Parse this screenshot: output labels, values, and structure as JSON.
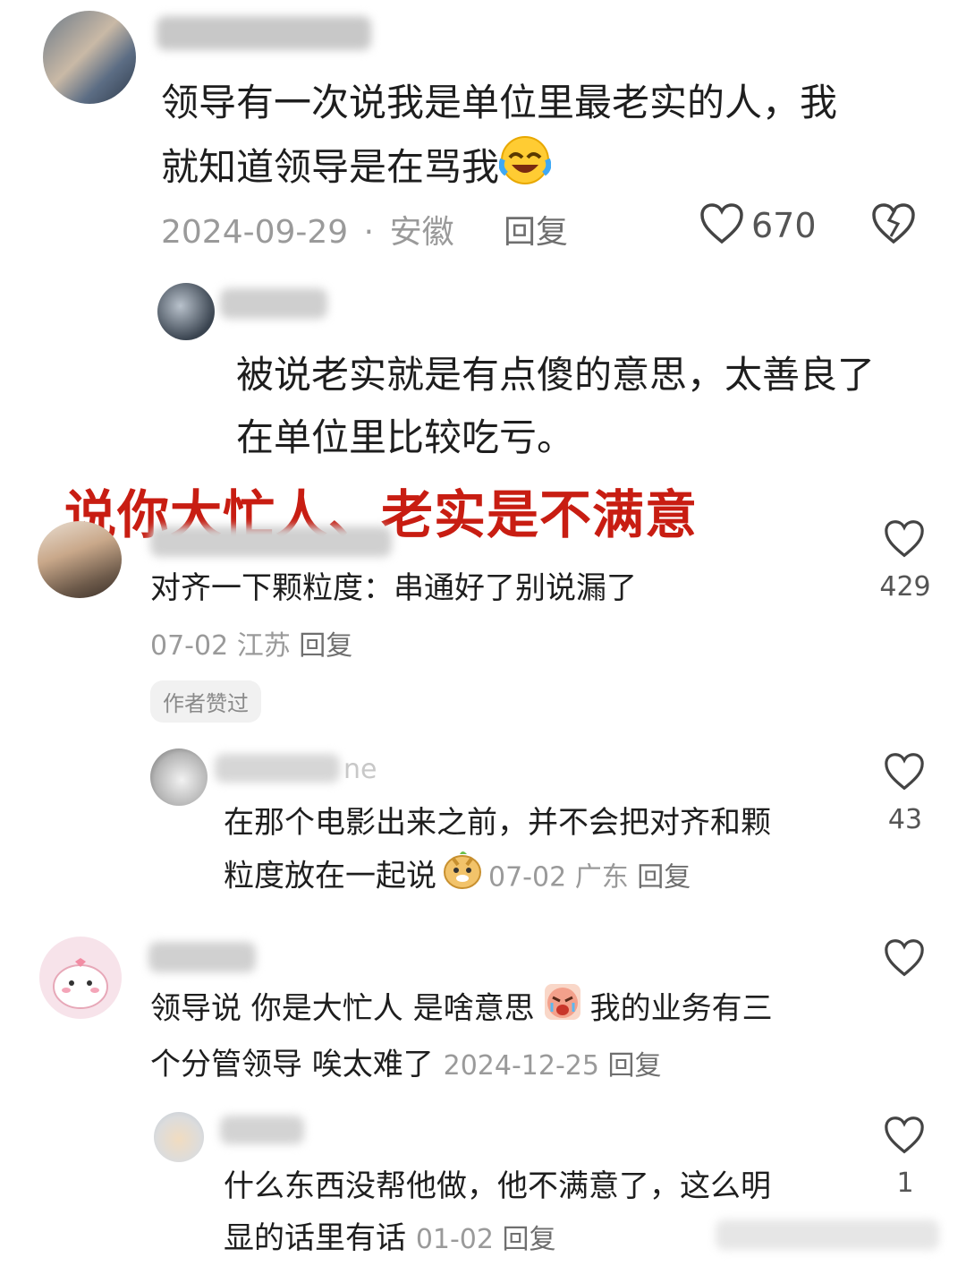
{
  "comment1": {
    "text_line1": "领导有一次说我是单位里最老实的人，我",
    "text_line2": "就知道领导是在骂我",
    "date": "2024-09-29",
    "sep": "·",
    "location": "安徽",
    "reply": "回复",
    "likes": "670"
  },
  "reply1": {
    "text_line1": "被说老实就是有点傻的意思，太善良了",
    "text_line2": "在单位里比较吃亏。"
  },
  "headline": "说你大忙人、老实是不满意",
  "comment2": {
    "text": "对齐一下颗粒度：串通好了别说漏了",
    "date": "07-02",
    "location": "江苏",
    "reply": "回复",
    "tag": "作者赞过",
    "likes": "429"
  },
  "reply2": {
    "name_fragment": "ne",
    "text_line1": "在那个电影出来之前，并不会把对齐和颗",
    "text_line2": "粒度放在一起说",
    "date": "07-02",
    "location": "广东",
    "reply": "回复",
    "likes": "43"
  },
  "comment3": {
    "text_line1_a": "领导说 你是大忙人 是啥意思",
    "text_line1_b": "我的业务有三",
    "text_line2": "个分管领导 唉太难了",
    "date": "2024-12-25",
    "reply": "回复"
  },
  "reply3": {
    "text_line1": "什么东西没帮他做，他不满意了，这么明",
    "text_line2": "显的话里有话",
    "date": "01-02",
    "reply": "回复",
    "likes": "1"
  },
  "colors": {
    "headline_red": "#c81d12",
    "meta_gray": "#9a9a9a",
    "tag_bg": "#f1f1f1"
  },
  "icons": [
    "heart-outline-icon",
    "dislike-heart-icon",
    "laughing-crying-emoji",
    "doge-emoji",
    "angry-crying-emoji"
  ]
}
